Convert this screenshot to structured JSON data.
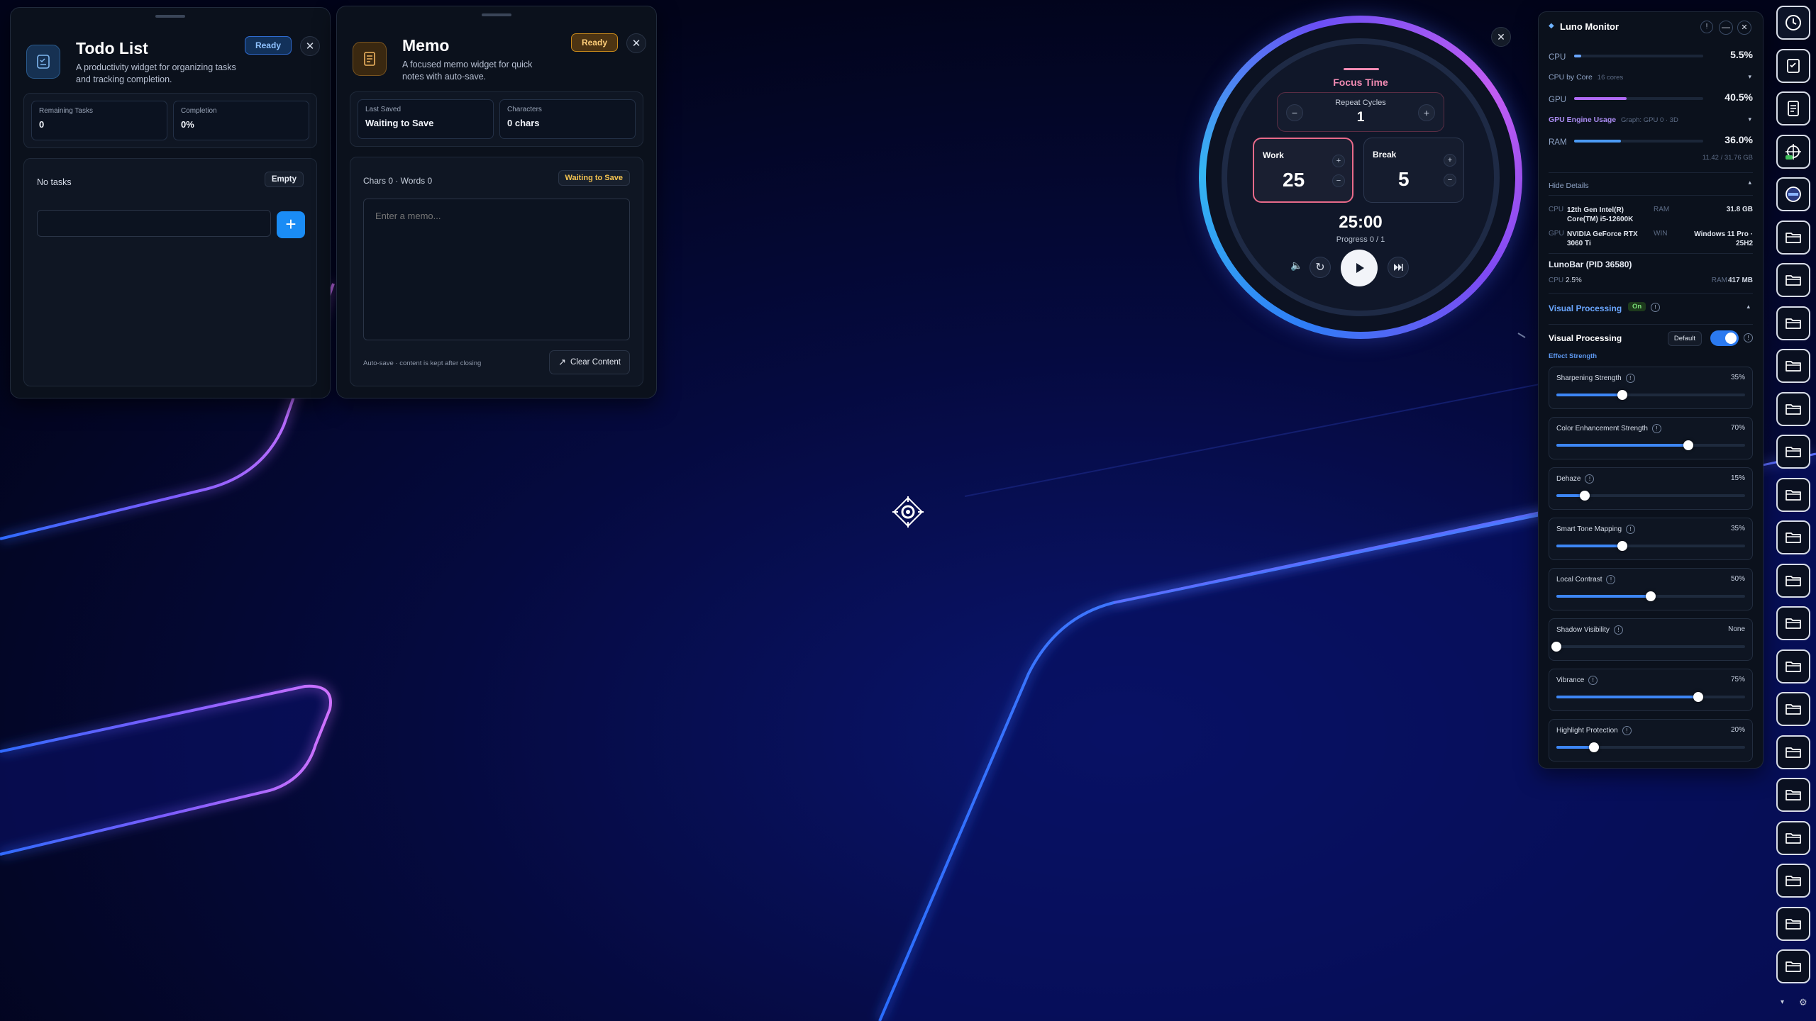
{
  "todo": {
    "title": "Todo List",
    "description": "A productivity widget for organizing tasks and tracking completion.",
    "status": "Ready",
    "close": "✕",
    "stats": [
      {
        "label": "Remaining Tasks",
        "value": "0"
      },
      {
        "label": "Completion",
        "value": "0%"
      }
    ],
    "empty_text": "No tasks",
    "empty_badge": "Empty",
    "input_placeholder": "",
    "add_button": "+"
  },
  "memo": {
    "title": "Memo",
    "description": "A focused memo widget for quick notes with auto-save.",
    "status": "Ready",
    "close": "✕",
    "stats": [
      {
        "label": "Last Saved",
        "value": "Waiting to Save"
      },
      {
        "label": "Characters",
        "value": "0 chars"
      }
    ],
    "counter": "Chars 0 · Words 0",
    "save_status": "Waiting to Save",
    "placeholder": "Enter a memo...",
    "footer_note": "Auto-save · content is kept after closing",
    "clear_button": "Clear Content"
  },
  "pomodoro": {
    "title": "Focus Time",
    "repeat_label": "Repeat Cycles",
    "repeat_value": "1",
    "work_label": "Work",
    "work_value": "25",
    "break_label": "Break",
    "break_value": "5",
    "time": "25:00",
    "progress": "Progress 0 / 1",
    "minus": "−",
    "plus": "+"
  },
  "monitor": {
    "title": "Luno Monitor",
    "cpu_label": "CPU",
    "cpu_value": "5.5%",
    "cpu_fraction": 0.055,
    "cpu_core_label": "CPU by Core",
    "cpu_core_count": "16 cores",
    "gpu_label": "GPU",
    "gpu_value": "40.5%",
    "gpu_fraction": 0.405,
    "gpu_engine_label": "GPU Engine Usage",
    "gpu_engine_detail": "Graph: GPU 0 · 3D",
    "ram_label": "RAM",
    "ram_value": "36.0%",
    "ram_fraction": 0.36,
    "ram_detail": "11.42 / 31.76 GB",
    "hide_details": "Hide Details",
    "spec_cpu_tag": "CPU",
    "spec_cpu": "12th Gen Intel(R) Core(TM) i5-12600K",
    "spec_ram_tag": "RAM",
    "spec_ram": "31.8 GB",
    "spec_gpu_tag": "GPU",
    "spec_gpu": "NVIDIA GeForce RTX 3060 Ti",
    "spec_win_tag": "WIN",
    "spec_win": "Windows 11 Pro · 25H2",
    "process": "LunoBar (PID 36580)",
    "proc_cpu_label": "CPU",
    "proc_cpu": "2.5%",
    "proc_ram_label": "RAM",
    "proc_ram": "417 MB",
    "vp_header": "Visual Processing",
    "vp_on": "On",
    "vp_title": "Visual Processing",
    "vp_default": "Default",
    "vp_toggle": true,
    "effect_strength": "Effect Strength",
    "sliders": [
      {
        "label": "Sharpening Strength",
        "value": "35%",
        "level": 0.35
      },
      {
        "label": "Color Enhancement Strength",
        "value": "70%",
        "level": 0.7
      },
      {
        "label": "Dehaze",
        "value": "15%",
        "level": 0.15
      },
      {
        "label": "Smart Tone Mapping",
        "value": "35%",
        "level": 0.35
      },
      {
        "label": "Local Contrast",
        "value": "50%",
        "level": 0.5
      },
      {
        "label": "Shadow Visibility",
        "value": "None",
        "level": 0.0
      },
      {
        "label": "Vibrance",
        "value": "75%",
        "level": 0.75
      },
      {
        "label": "Highlight Protection",
        "value": "20%",
        "level": 0.2
      }
    ]
  },
  "dock": {
    "items": [
      "clock-icon",
      "checklist-icon",
      "memo-icon",
      "crosshair-icon",
      "monitor-icon",
      "folder-icon",
      "folder-icon",
      "folder-icon",
      "folder-icon",
      "folder-icon",
      "folder-icon",
      "folder-icon",
      "folder-icon",
      "folder-icon",
      "folder-icon",
      "folder-icon",
      "folder-icon",
      "folder-icon",
      "folder-icon",
      "folder-icon",
      "folder-icon",
      "folder-icon",
      "folder-icon"
    ]
  },
  "colors": {
    "accent_blue": "#1a8cf5",
    "ready_todo": "#2b6fe0",
    "ready_memo": "#c98a1a",
    "focus_pink": "#f28bb3"
  }
}
